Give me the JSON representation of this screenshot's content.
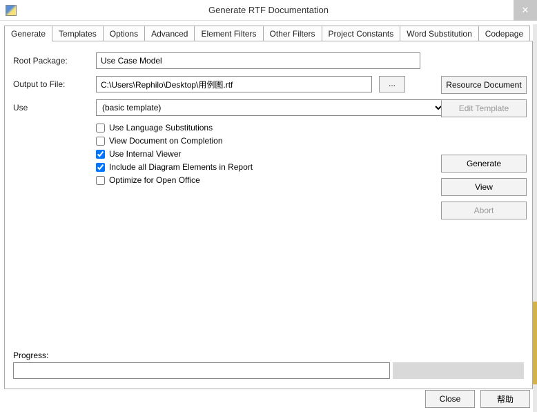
{
  "title": "Generate RTF Documentation",
  "tabs": [
    {
      "label": "Generate"
    },
    {
      "label": "Templates"
    },
    {
      "label": "Options"
    },
    {
      "label": "Advanced"
    },
    {
      "label": "Element Filters"
    },
    {
      "label": "Other Filters"
    },
    {
      "label": "Project Constants"
    },
    {
      "label": "Word Substitution"
    },
    {
      "label": "Codepage"
    }
  ],
  "form": {
    "root_label": "Root Package:",
    "root_value": "Use Case Model",
    "output_label": "Output to File:",
    "output_value": "C:\\Users\\Rephilo\\Desktop\\用例图.rtf",
    "browse_label": "...",
    "use_label": "Use",
    "use_value": "(basic template)"
  },
  "checks": {
    "lang_sub": "Use Language Substitutions",
    "view_complete": "View Document on Completion",
    "internal_viewer": "Use Internal Viewer",
    "include_diagram": "Include all Diagram Elements in Report",
    "open_office": "Optimize for Open Office"
  },
  "side_buttons": {
    "resource": "Resource Document",
    "edit_template": "Edit Template",
    "generate": "Generate",
    "view": "View",
    "abort": "Abort"
  },
  "progress_label": "Progress:",
  "footer": {
    "close": "Close",
    "help": "帮助"
  }
}
